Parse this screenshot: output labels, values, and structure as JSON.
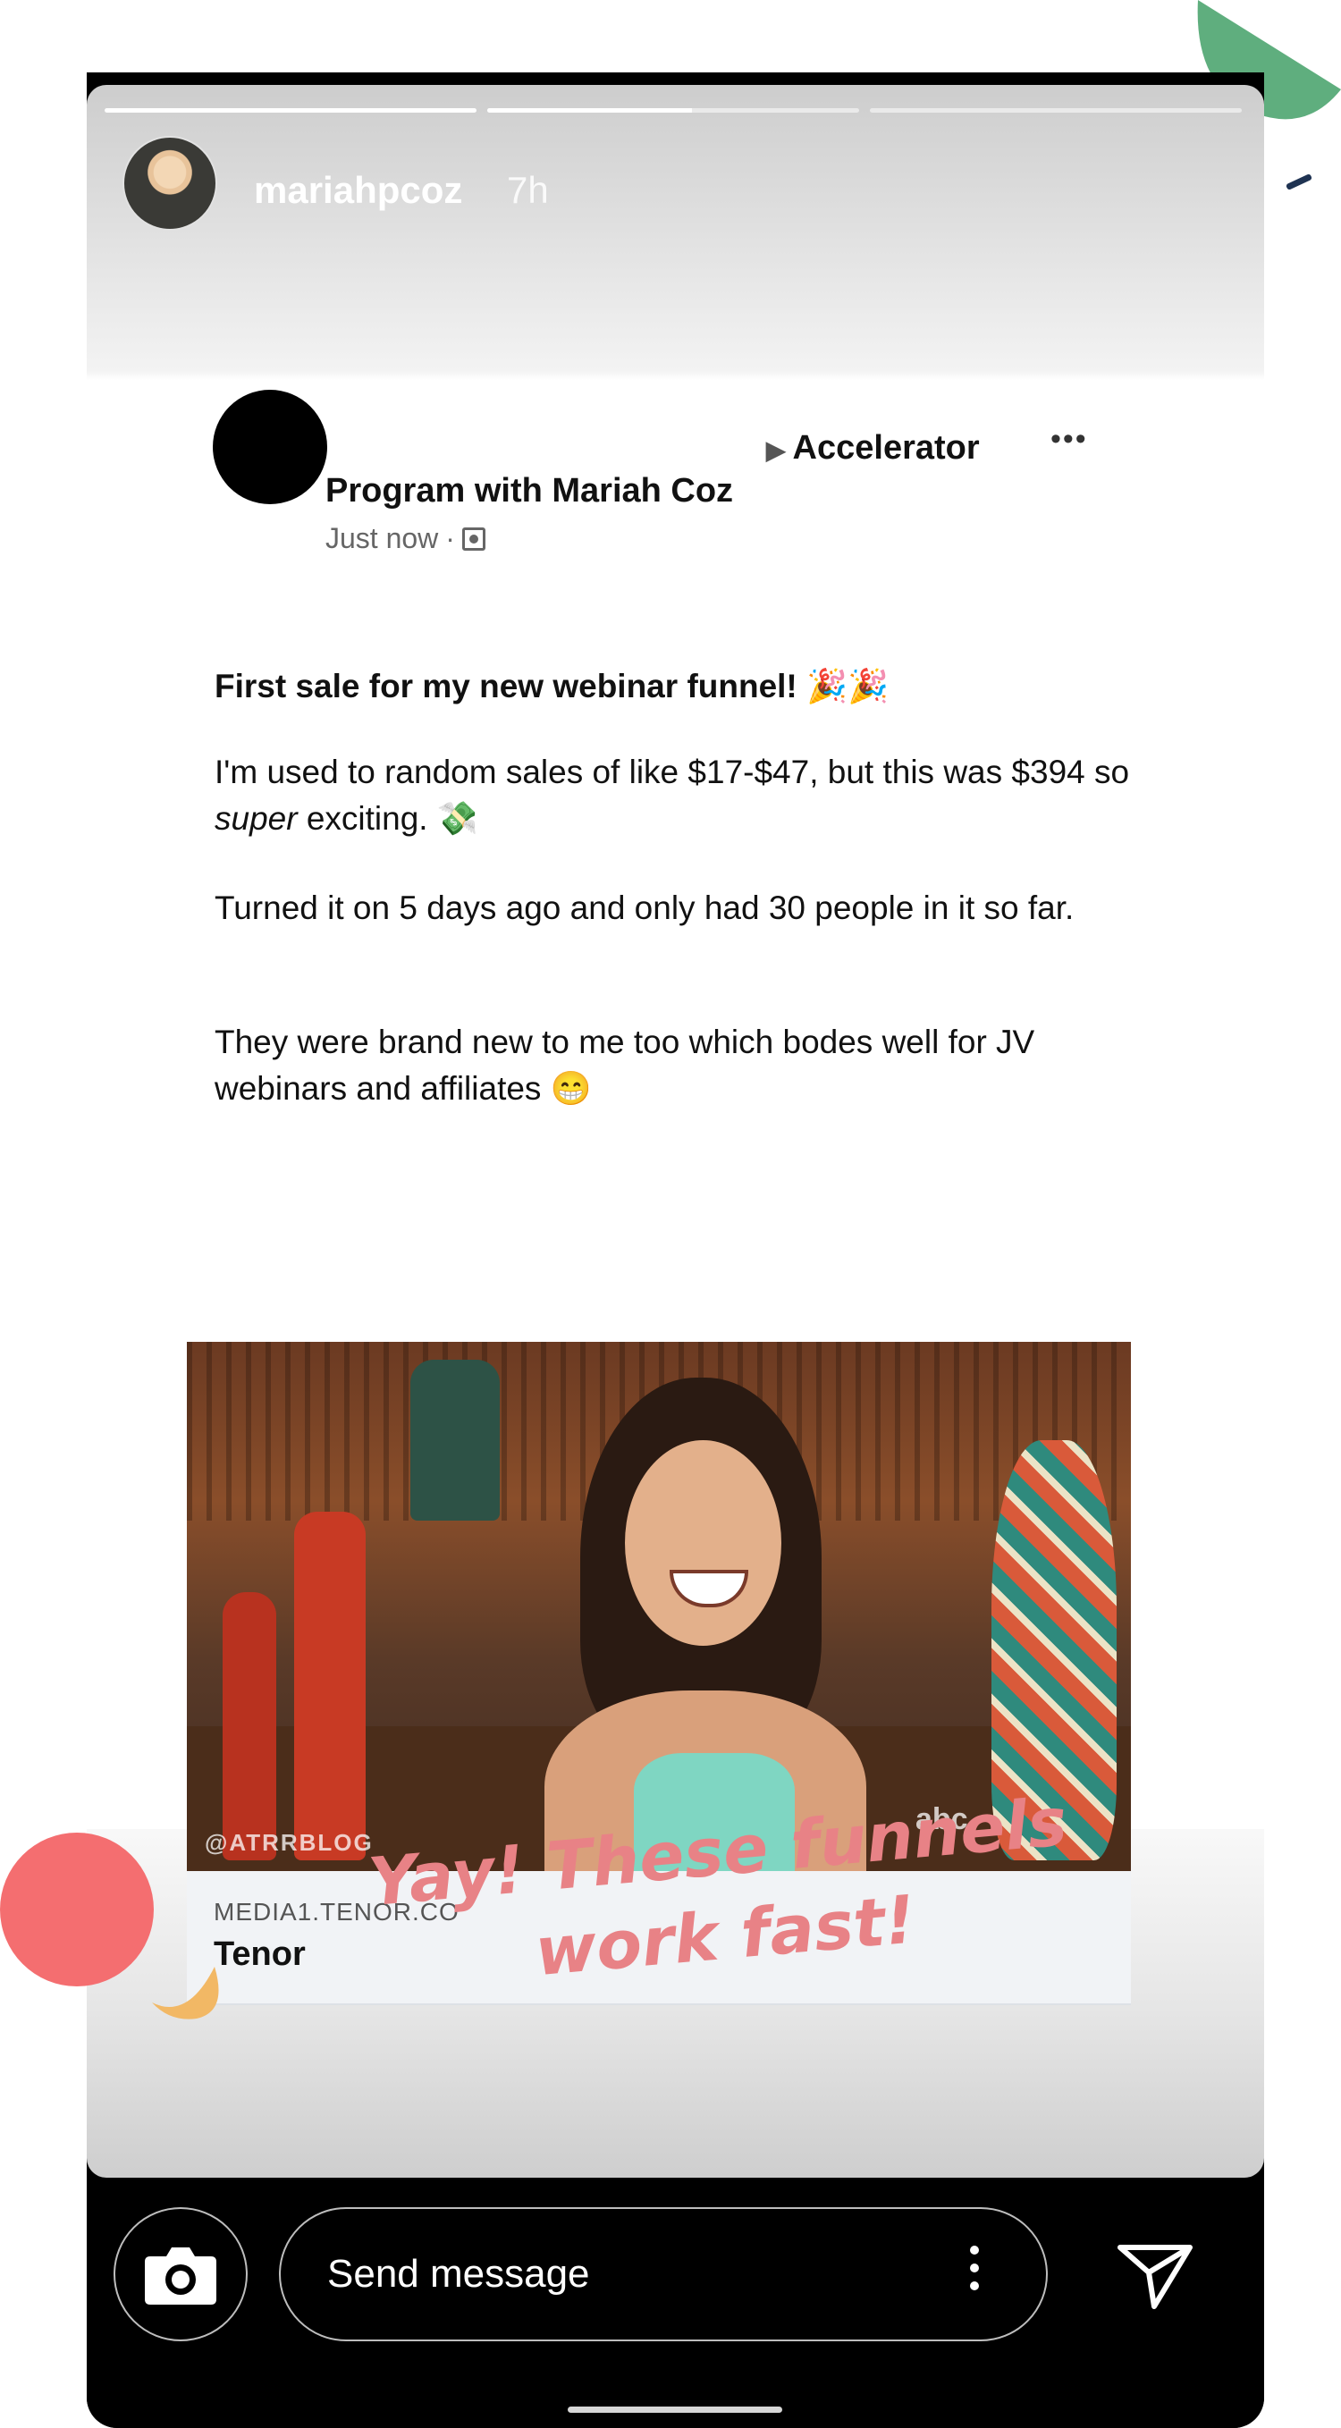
{
  "story": {
    "username": "mariahpcoz",
    "time_ago": "7h",
    "progress": [
      1.0,
      0.55,
      0.0
    ]
  },
  "post": {
    "group_name_line1": "Accelerator",
    "group_name_line2": "Program with Mariah Coz",
    "timestamp": "Just now",
    "more_label": "•••",
    "headline": "First sale for my new webinar funnel! 🎉🎉",
    "paragraph1_a": "I'm used to random sales of like $17-$47, but this was $394 so ",
    "paragraph1_em": "super",
    "paragraph1_b": " exciting. 💸",
    "paragraph2": "Turned it on 5 days ago and only had 30 people in it so far.",
    "paragraph3": "They were brand new to me too which bodes well for JV webinars and affiliates 😁",
    "gif_watermark": "@ATRRBLOG",
    "gif_logo": "abc",
    "link_domain": "MEDIA1.TENOR.CO",
    "link_title": "Tenor"
  },
  "caption": {
    "line1": "Yay! These funnels",
    "line2": "work fast!"
  },
  "bottom_bar": {
    "message_placeholder": "Send message",
    "camera_icon": "camera-icon",
    "send_icon": "send-icon",
    "more_icon": "more-vertical-icon"
  },
  "colors": {
    "caption": "#e88286",
    "deco_green": "#5fae7e",
    "deco_coral": "#f46e70",
    "deco_yellow": "#f2b865",
    "deco_navy": "#1f3352"
  }
}
